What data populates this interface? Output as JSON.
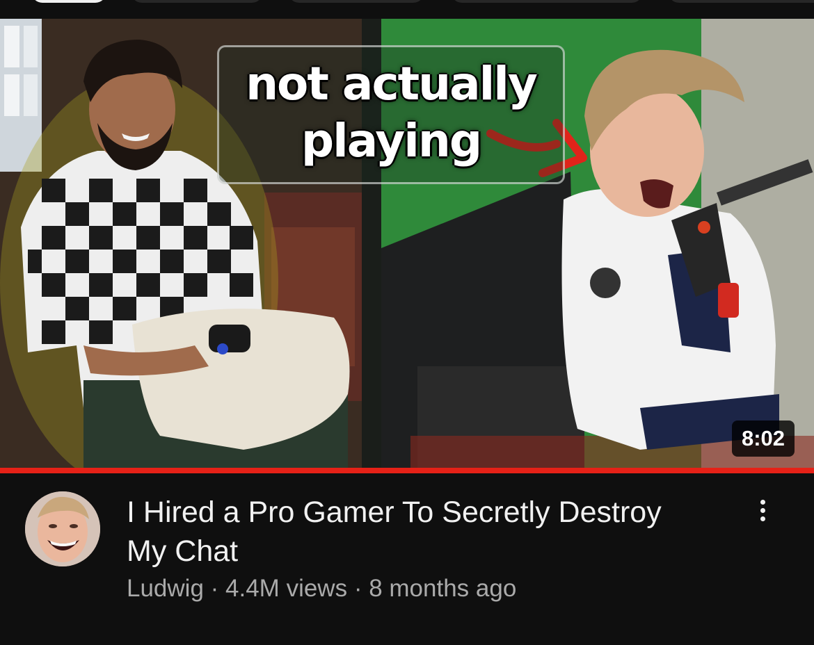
{
  "thumbnail": {
    "overlay_line1": "not actually",
    "overlay_line2": "playing",
    "duration": "8:02",
    "watch_progress": 1.0,
    "progress_color": "#e62117"
  },
  "video": {
    "title": "I Hired a Pro Gamer To Secretly Destroy My Chat",
    "channel": "Ludwig",
    "separator": " · ",
    "views": "4.4M views",
    "age": "8 months ago"
  },
  "icons": {
    "menu": "more-vert-icon",
    "avatar": "channel-avatar"
  }
}
